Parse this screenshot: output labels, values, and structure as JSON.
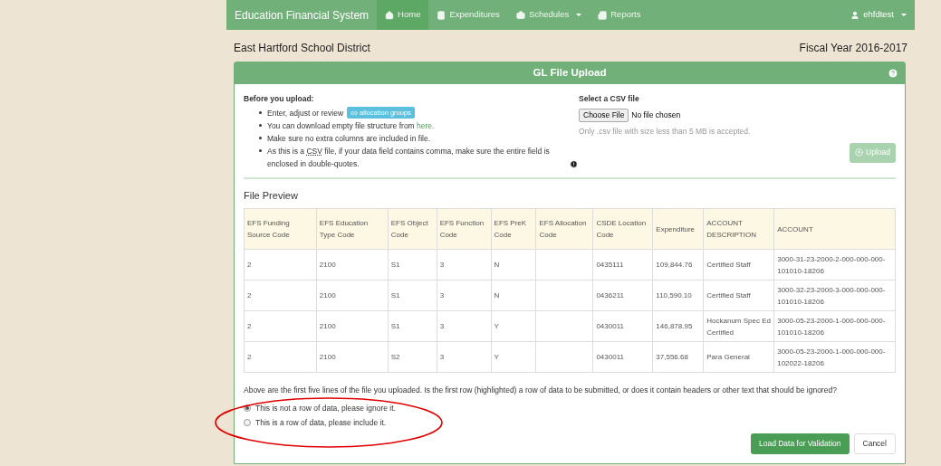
{
  "navbar": {
    "brand": "Education Financial System",
    "items": [
      {
        "label": "Home",
        "selected": true,
        "dropdown": false
      },
      {
        "label": "Expenditures",
        "selected": false,
        "dropdown": false
      },
      {
        "label": "Schedules",
        "selected": false,
        "dropdown": true
      },
      {
        "label": "Reports",
        "selected": false,
        "dropdown": false
      }
    ],
    "user": "ehfdtest"
  },
  "district": "East Hartford School District",
  "fiscal_year": "Fiscal Year 2016-2017",
  "panel": {
    "title": "GL File Upload",
    "before": {
      "heading": "Before you upload:",
      "items": [
        {
          "kind": "button",
          "text": "Enter, adjust or review",
          "button": "allocation groups"
        },
        {
          "kind": "link",
          "text": "You can download empty file structure from",
          "link": "here."
        },
        {
          "kind": "plain",
          "text": "Make sure no extra columns are included in file."
        },
        {
          "kind": "abbr",
          "pre": "As this is a",
          "abbr": "CSV",
          "text": "file, if your data field contains comma, make sure the entire field is enclosed in double-quotes."
        }
      ]
    },
    "select": {
      "heading": "Select a CSV file",
      "button": "Choose File",
      "status": "No file chosen",
      "hint": "Only .csv file with size less than 5 MB is accepted.",
      "upload": "Upload",
      "upload_disabled": true
    },
    "preview_title": "File Preview",
    "table": {
      "columns": [
        "EFS Funding Source Code",
        "EFS Education Type Code",
        "EFS Object Code",
        "EFS Function Code",
        "EFS PreK Code",
        "EFS Allocation Code",
        "CSDE Location Code",
        "Expenditure",
        "ACCOUNT DESCRIPTION",
        "ACCOUNT"
      ],
      "header_highlighted": true,
      "rows": [
        [
          "2",
          "2100",
          "S1",
          "3",
          "N",
          "",
          "0435111",
          "109,844.76",
          "Certified Staff",
          "3000-31-23-2000-2-000-000-000-101010-18206"
        ],
        [
          "2",
          "2100",
          "S1",
          "3",
          "N",
          "",
          "0436211",
          "110,590.10",
          "Certified Staff",
          "3000-32-23-2000-3-000-000-000-101010-18206"
        ],
        [
          "2",
          "2100",
          "S1",
          "3",
          "Y",
          "",
          "0430011",
          "146,878.95",
          "Hockanum Spec Ed Certified",
          "3000-05-23-2000-1-000-000-000-101010-18206"
        ],
        [
          "2",
          "2100",
          "S2",
          "3",
          "Y",
          "",
          "0430011",
          "37,556.68",
          "Para General",
          "3000-05-23-2000-1-000-000-000-102022-18206"
        ]
      ]
    },
    "question": "Above are the first five lines of the file you uploaded. Is the first row (highlighted) a row of data to be submitted, or does it contain headers or other text that should be ignored?",
    "options": [
      {
        "label": "This is not a row of data, please ignore it.",
        "selected": true
      },
      {
        "label": "This is a row of data, please include it.",
        "selected": false
      }
    ],
    "buttons": [
      {
        "label": "Load Data for Validation",
        "kind": "primary"
      },
      {
        "label": "Cancel",
        "kind": "default"
      }
    ]
  },
  "annotation": {
    "kind": "ellipse",
    "color": "#e00000"
  }
}
